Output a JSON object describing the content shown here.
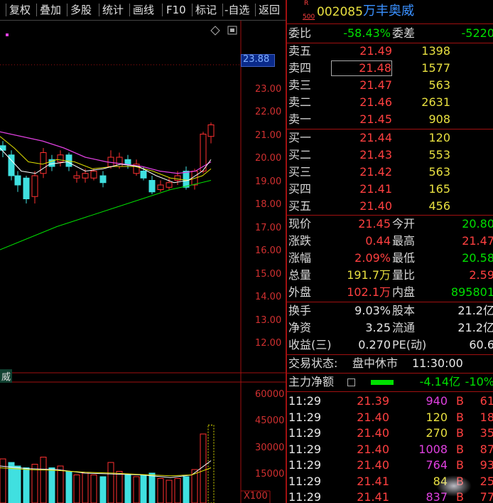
{
  "toolbar": {
    "items": [
      "复权",
      "叠加",
      "多股",
      "统计",
      "画线",
      "F10",
      "标记",
      "-自选",
      "返回"
    ]
  },
  "chart": {
    "price_marker": "23.88",
    "price_ticks": [
      "23.00",
      "22.00",
      "21.00",
      "20.00",
      "19.00",
      "18.00",
      "17.00",
      "16.00",
      "15.00",
      "14.00",
      "13.00",
      "12.00"
    ],
    "volume_ticks": [
      "60000",
      "45000",
      "30000",
      "15000"
    ],
    "volume_unit": "X100",
    "stock_label_fragment": "威",
    "colors": {
      "up": "#ff3030",
      "down": "#40e0e0",
      "ma5": "#ffffff",
      "ma10": "#e0e000",
      "ma20": "#e040e0",
      "ma60": "#00e000"
    }
  },
  "header": {
    "badge_top": "R",
    "badge_bottom": "500",
    "code": "002085",
    "name": "万丰奥威"
  },
  "commission": {
    "ratio_label": "委比",
    "ratio_value": "-58.43%",
    "diff_label": "委差",
    "diff_value": "-5220"
  },
  "asks": [
    {
      "label": "卖五",
      "price": "21.49",
      "volume": "1398"
    },
    {
      "label": "卖四",
      "price": "21.48",
      "volume": "1577"
    },
    {
      "label": "卖三",
      "price": "21.47",
      "volume": "563"
    },
    {
      "label": "卖二",
      "price": "21.46",
      "volume": "2631"
    },
    {
      "label": "卖一",
      "price": "21.45",
      "volume": "908"
    }
  ],
  "bids": [
    {
      "label": "买一",
      "price": "21.44",
      "volume": "120"
    },
    {
      "label": "买二",
      "price": "21.43",
      "volume": "553"
    },
    {
      "label": "买三",
      "price": "21.42",
      "volume": "563"
    },
    {
      "label": "买四",
      "price": "21.41",
      "volume": "165"
    },
    {
      "label": "买五",
      "price": "21.40",
      "volume": "456"
    }
  ],
  "quote": [
    {
      "l1": "现价",
      "v1": "21.45",
      "c1": "red",
      "l2": "今开",
      "v2": "20.80",
      "c2": "grn"
    },
    {
      "l1": "涨跌",
      "v1": "0.44",
      "c1": "red",
      "l2": "最高",
      "v2": "21.47",
      "c2": "red"
    },
    {
      "l1": "涨幅",
      "v1": "2.09%",
      "c1": "red",
      "l2": "最低",
      "v2": "20.58",
      "c2": "grn"
    },
    {
      "l1": "总量",
      "v1": "191.7万",
      "c1": "yel",
      "l2": "量比",
      "v2": "2.59",
      "c2": "red"
    },
    {
      "l1": "外盘",
      "v1": "102.1万",
      "c1": "red",
      "l2": "内盘",
      "v2": "895801",
      "c2": "grn"
    }
  ],
  "quote2": [
    {
      "l1": "换手",
      "v1": "9.03%",
      "l2": "股本",
      "v2": "21.2亿"
    },
    {
      "l1": "净资",
      "v1": "3.25",
      "l2": "流通",
      "v2": "21.2亿"
    },
    {
      "l1": "收益(三)",
      "v1": "0.270",
      "l2": "PE(动)",
      "v2": "60.6"
    }
  ],
  "status": {
    "label": "交易状态:",
    "value": "盘中休市",
    "time": "11:30:00"
  },
  "main_force": {
    "label": "主力净额",
    "value": "-4.14亿",
    "pct": "-10%"
  },
  "ticks": [
    {
      "time": "11:29",
      "price": "21.39",
      "vol": "940",
      "side": "B",
      "n": "61"
    },
    {
      "time": "11:29",
      "price": "21.40",
      "vol": "120",
      "side": "B",
      "n": "18"
    },
    {
      "time": "11:29",
      "price": "21.40",
      "vol": "270",
      "side": "B",
      "n": "35"
    },
    {
      "time": "11:29",
      "price": "21.40",
      "vol": "1008",
      "side": "B",
      "n": "87"
    },
    {
      "time": "11:29",
      "price": "21.40",
      "vol": "764",
      "side": "B",
      "n": "93"
    },
    {
      "time": "11:29",
      "price": "21.41",
      "vol": "84",
      "side": "B",
      "n": "25"
    },
    {
      "time": "11:29",
      "price": "21.41",
      "vol": "837",
      "side": "B",
      "n": "77"
    }
  ]
}
